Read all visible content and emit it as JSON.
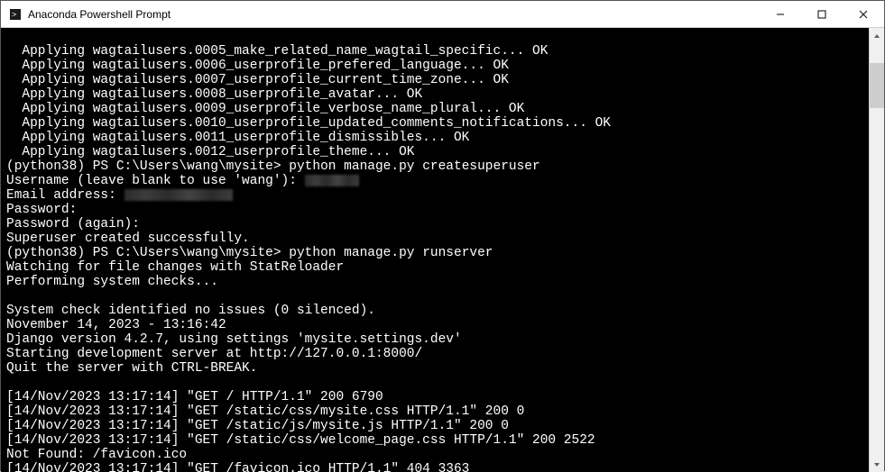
{
  "window": {
    "title": "Anaconda Powershell Prompt"
  },
  "prompt": {
    "env": "(python38)",
    "path": "PS C:\\Users\\wang\\mysite>",
    "cmd_createsuperuser": "python manage.py createsuperuser",
    "cmd_runserver": "python manage.py runserver"
  },
  "migrations": [
    "  Applying wagtailusers.0005_make_related_name_wagtail_specific... OK",
    "  Applying wagtailusers.0006_userprofile_prefered_language... OK",
    "  Applying wagtailusers.0007_userprofile_current_time_zone... OK",
    "  Applying wagtailusers.0008_userprofile_avatar... OK",
    "  Applying wagtailusers.0009_userprofile_verbose_name_plural... OK",
    "  Applying wagtailusers.0010_userprofile_updated_comments_notifications... OK",
    "  Applying wagtailusers.0011_userprofile_dismissibles... OK",
    "  Applying wagtailusers.0012_userprofile_theme... OK"
  ],
  "superuser": {
    "username_prompt": "Username (leave blank to use 'wang'): ",
    "email_prompt": "Email address: ",
    "password_prompt": "Password:",
    "password_again_prompt": "Password (again):",
    "success": "Superuser created successfully."
  },
  "server": {
    "watching": "Watching for file changes with StatReloader",
    "performing": "Performing system checks...",
    "blank": "",
    "syscheck": "System check identified no issues (0 silenced).",
    "timestamp": "November 14, 2023 - 13:16:42",
    "django": "Django version 4.2.7, using settings 'mysite.settings.dev'",
    "starting": "Starting development server at http://127.0.0.1:8000/",
    "quit": "Quit the server with CTRL-BREAK."
  },
  "requests": [
    "[14/Nov/2023 13:17:14] \"GET / HTTP/1.1\" 200 6790",
    "[14/Nov/2023 13:17:14] \"GET /static/css/mysite.css HTTP/1.1\" 200 0",
    "[14/Nov/2023 13:17:14] \"GET /static/js/mysite.js HTTP/1.1\" 200 0",
    "[14/Nov/2023 13:17:14] \"GET /static/css/welcome_page.css HTTP/1.1\" 200 2522",
    "Not Found: /favicon.ico",
    "[14/Nov/2023 13:17:14] \"GET /favicon.ico HTTP/1.1\" 404 3363"
  ]
}
